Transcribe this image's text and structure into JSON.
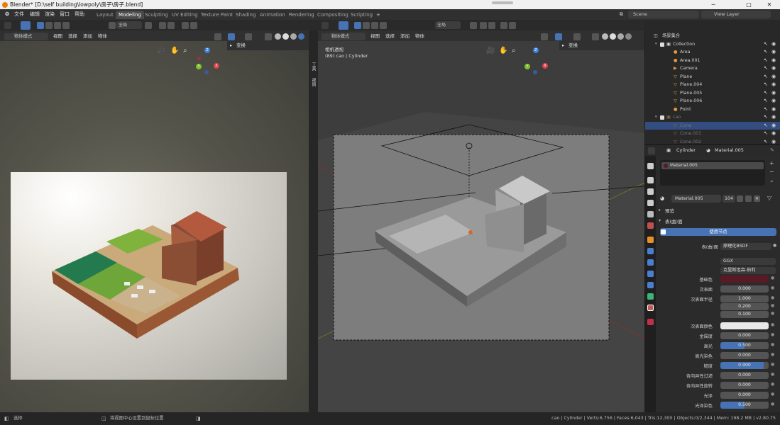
{
  "titlebar": {
    "title": "Blender* [D:\\self building\\lowpoly\\房子\\房子.blend]"
  },
  "menu": [
    "文件",
    "编辑",
    "渲染",
    "窗口",
    "帮助"
  ],
  "workspaces": [
    "Layout",
    "Modeling",
    "Sculpting",
    "UV Editing",
    "Texture Paint",
    "Shading",
    "Animation",
    "Rendering",
    "Compositing",
    "Scripting"
  ],
  "workspace_add": "+",
  "scene": {
    "icon": "scene-icon",
    "name": "Scene",
    "view_layer": "View Layer"
  },
  "left_view": {
    "mode": "物体模式",
    "menus": [
      "视图",
      "选择",
      "添加",
      "物体"
    ],
    "transform": "全局",
    "sidebar_panel": "变换",
    "side_tabs": [
      "工具",
      "视图"
    ]
  },
  "right_view": {
    "mode": "物体模式",
    "menus": [
      "视图",
      "选择",
      "添加",
      "物体"
    ],
    "transform": "全局",
    "sidebar_panel": "变换",
    "camera_label": "相机透视",
    "object_label": "(89) cao | Cylinder"
  },
  "outliner": {
    "search_placeholder": "",
    "scene_collection": "场景集合",
    "rows": [
      {
        "name": "Collection",
        "icon": "collection-icon",
        "selected": false,
        "dim": false,
        "indent": 1
      },
      {
        "name": "Area",
        "icon": "light-icon",
        "selected": false,
        "dim": false,
        "indent": 2
      },
      {
        "name": "Area.001",
        "icon": "light-icon",
        "selected": false,
        "dim": false,
        "indent": 2
      },
      {
        "name": "Camera",
        "icon": "camera-icon",
        "selected": false,
        "dim": false,
        "indent": 2
      },
      {
        "name": "Plane",
        "icon": "mesh-icon",
        "selected": false,
        "dim": false,
        "indent": 2
      },
      {
        "name": "Plane.004",
        "icon": "mesh-icon",
        "selected": false,
        "dim": false,
        "indent": 2
      },
      {
        "name": "Plane.005",
        "icon": "mesh-icon",
        "selected": false,
        "dim": false,
        "indent": 2
      },
      {
        "name": "Plane.006",
        "icon": "mesh-icon",
        "selected": false,
        "dim": false,
        "indent": 2
      },
      {
        "name": "Point",
        "icon": "light-icon",
        "selected": false,
        "dim": false,
        "indent": 2
      },
      {
        "name": "cao",
        "icon": "collection-icon",
        "selected": false,
        "dim": true,
        "indent": 1
      },
      {
        "name": "Cone",
        "icon": "mesh-icon",
        "selected": true,
        "dim": true,
        "indent": 2
      },
      {
        "name": "Cone.001",
        "icon": "mesh-icon",
        "selected": false,
        "dim": true,
        "indent": 2
      },
      {
        "name": "Cone.002",
        "icon": "mesh-icon",
        "selected": false,
        "dim": true,
        "indent": 2
      }
    ]
  },
  "properties": {
    "object": "Cylinder",
    "material": "Material.005",
    "slot": "Material.005",
    "material_field": "Material.005",
    "users": "104",
    "preview": "预览",
    "surface": "表(曲)面",
    "use_nodes": "使用节点",
    "surface_label": "表(曲)面",
    "surface_value": "原理化BSDF",
    "distribution": "GGX",
    "subsurface_method": "克里斯坦森-伯利",
    "rows": [
      {
        "label": "基础色",
        "value": "",
        "kind": "color",
        "color": "#5a1a25"
      },
      {
        "label": "次表面",
        "value": "0.000",
        "kind": "num"
      },
      {
        "label": "次表面半径",
        "value": "1.000",
        "kind": "num"
      },
      {
        "label": "",
        "value": "0.200",
        "kind": "num"
      },
      {
        "label": "",
        "value": "0.100",
        "kind": "num"
      },
      {
        "label": "次表面颜色",
        "value": "",
        "kind": "color",
        "color": "#e8e8e8"
      },
      {
        "label": "金属度",
        "value": "0.000",
        "kind": "num"
      },
      {
        "label": "高光",
        "value": "0.500",
        "kind": "blue",
        "fill": 0.5
      },
      {
        "label": "高光染色",
        "value": "0.000",
        "kind": "num"
      },
      {
        "label": "糙度",
        "value": "0.900",
        "kind": "blue",
        "fill": 0.9
      },
      {
        "label": "各向异性过滤",
        "value": "0.000",
        "kind": "num"
      },
      {
        "label": "各向异性旋转",
        "value": "0.000",
        "kind": "num"
      },
      {
        "label": "光泽",
        "value": "0.000",
        "kind": "num"
      },
      {
        "label": "光泽染色",
        "value": "0.500",
        "kind": "blue",
        "fill": 0.5
      }
    ]
  },
  "statusbar": {
    "left": "选择",
    "middle": "将视图中心设置到鼠标位置",
    "right": "cao | Cylinder | Verts:6,756 | Faces:6,043 | Tris:12,300 | Objects:0/2,344 | Mem: 198.2 MB | v2.80.75"
  },
  "colors": {
    "accent": "#4772b3",
    "selection": "#334d80",
    "axis_x": "#e0414d",
    "axis_y": "#7fbf2a",
    "axis_z": "#3b82e0"
  }
}
